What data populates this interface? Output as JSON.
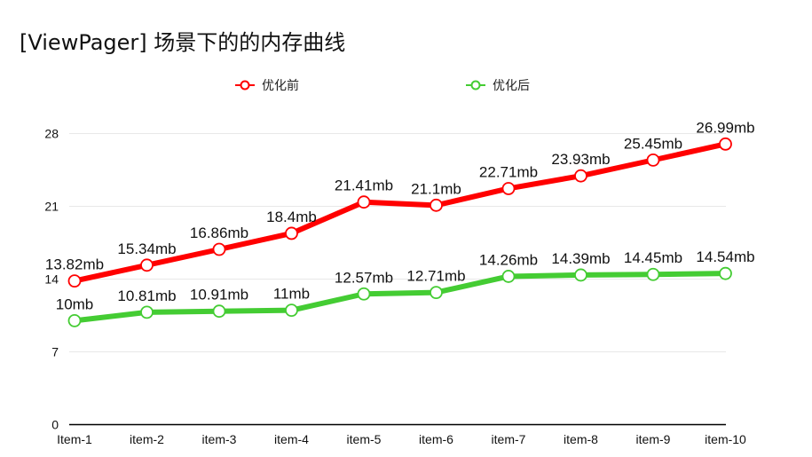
{
  "chart_data": {
    "type": "line",
    "title": "[ViewPager] 场景下的的内存曲线",
    "categories": [
      "Item-1",
      "item-2",
      "item-3",
      "item-4",
      "item-5",
      "item-6",
      "item-7",
      "item-8",
      "item-9",
      "item-10"
    ],
    "yticks": [
      "0",
      "7",
      "14",
      "21",
      "28"
    ],
    "ylim": [
      0,
      28
    ],
    "grid": true,
    "legend_position": "top",
    "series": [
      {
        "name": "优化前",
        "color": "#ff0000",
        "values": [
          13.82,
          15.34,
          16.86,
          18.4,
          21.41,
          21.1,
          22.71,
          23.93,
          25.45,
          26.99
        ],
        "labels": [
          "13.82mb",
          "15.34mb",
          "16.86mb",
          "18.4mb",
          "21.41mb",
          "21.1mb",
          "22.71mb",
          "23.93mb",
          "25.45mb",
          "26.99mb"
        ]
      },
      {
        "name": "优化后",
        "color": "#44cc33",
        "values": [
          10,
          10.81,
          10.91,
          11,
          12.57,
          12.71,
          14.26,
          14.39,
          14.45,
          14.54
        ],
        "labels": [
          "10mb",
          "10.81mb",
          "10.91mb",
          "11mb",
          "12.57mb",
          "12.71mb",
          "14.26mb",
          "14.39mb",
          "14.45mb",
          "14.54mb"
        ]
      }
    ]
  }
}
